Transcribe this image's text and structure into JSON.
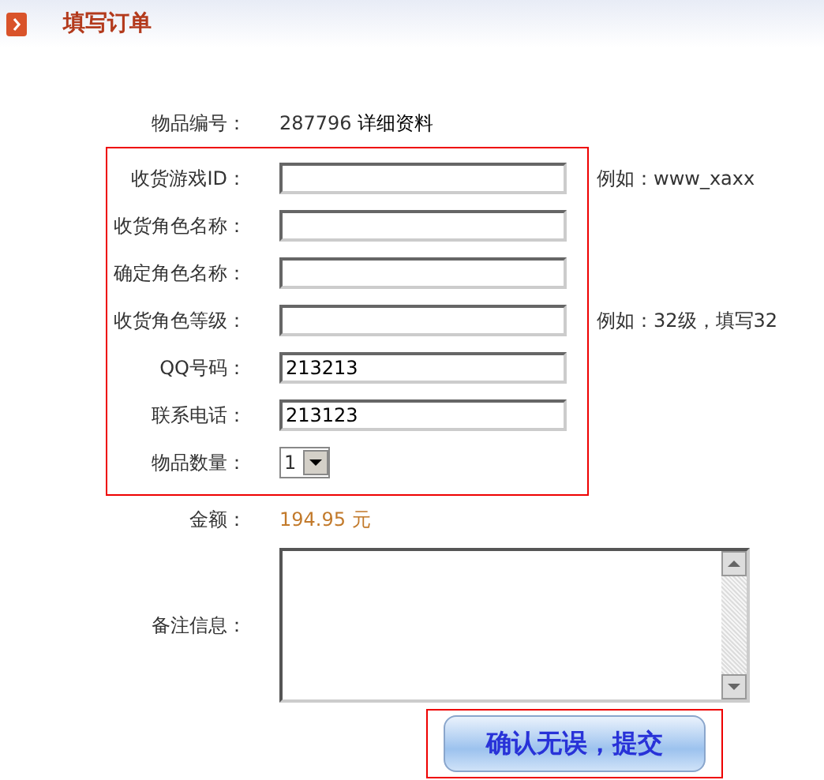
{
  "header": {
    "title": "填写订单"
  },
  "item_number": {
    "label": "物品编号：",
    "value": "287796",
    "link": "详细资料"
  },
  "fields": [
    {
      "kind": "text",
      "label": "收货游戏ID：",
      "hint": "例如：www_xaxx"
    },
    {
      "kind": "text",
      "label": "收货角色名称："
    },
    {
      "kind": "text",
      "label": "确定角色名称："
    },
    {
      "kind": "text",
      "label": "收货角色等级：",
      "hint": "例如：32级，填写32"
    },
    {
      "kind": "text",
      "label": "QQ号码：",
      "value": "213213"
    },
    {
      "kind": "text",
      "label": "联系电话：",
      "value": "213123"
    },
    {
      "kind": "select",
      "label": "物品数量：",
      "value": "1"
    }
  ],
  "amount": {
    "label": "金额：",
    "value": "194.95 元"
  },
  "remarks": {
    "label": "备注信息："
  },
  "submit_button": "确认无误，提交"
}
